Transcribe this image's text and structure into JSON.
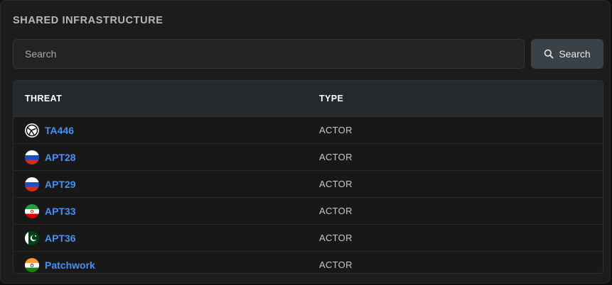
{
  "section": {
    "title": "SHARED INFRASTRUCTURE"
  },
  "search": {
    "placeholder": "Search",
    "value": "",
    "button_label": "Search",
    "button_icon": "search-icon"
  },
  "table": {
    "columns": [
      "THREAT",
      "TYPE"
    ],
    "rows": [
      {
        "threat": "TA446",
        "type": "ACTOR",
        "icon": "actor-globe-icon"
      },
      {
        "threat": "APT28",
        "type": "ACTOR",
        "icon": "russia-flag-icon"
      },
      {
        "threat": "APT29",
        "type": "ACTOR",
        "icon": "russia-flag-icon"
      },
      {
        "threat": "APT33",
        "type": "ACTOR",
        "icon": "iran-flag-icon"
      },
      {
        "threat": "APT36",
        "type": "ACTOR",
        "icon": "pakistan-flag-icon"
      },
      {
        "threat": "Patchwork",
        "type": "ACTOR",
        "icon": "india-flag-icon"
      }
    ]
  },
  "colors": {
    "link": "#4a90f0",
    "header_bg": "#24292b",
    "button_bg": "#3a4247"
  }
}
